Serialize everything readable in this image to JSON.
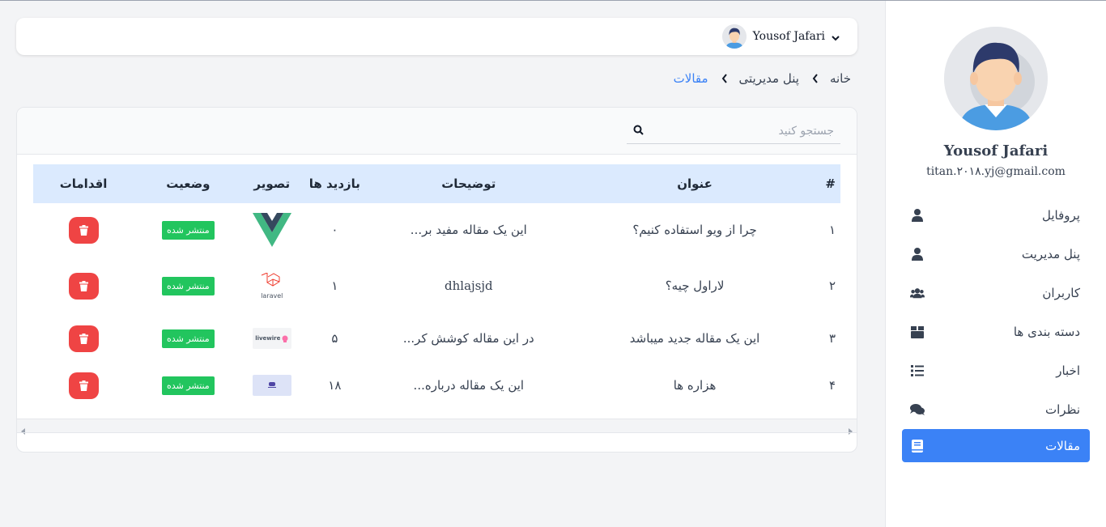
{
  "sidebar": {
    "user_name": "Yousof Jafari",
    "user_email": "titan.۲۰۱۸.yj@gmail.com",
    "avatar_icon": "user-avatar-icon",
    "items": [
      {
        "label": "پروفایل",
        "icon": "user-icon",
        "active": false
      },
      {
        "label": "پنل مدیریت",
        "icon": "user-icon",
        "active": false
      },
      {
        "label": "کاربران",
        "icon": "users-icon",
        "active": false
      },
      {
        "label": "دسته بندی ها",
        "icon": "box-icon",
        "active": false
      },
      {
        "label": "اخبار",
        "icon": "list-icon",
        "active": false
      },
      {
        "label": "نظرات",
        "icon": "comments-icon",
        "active": false
      },
      {
        "label": "مقالات",
        "icon": "book-icon",
        "active": true
      }
    ]
  },
  "topbar": {
    "user_name": "Yousof Jafari",
    "dropdown_icon": "chevron-down-icon"
  },
  "breadcrumb": {
    "items": [
      "خانه",
      "پنل مدیریتی",
      "مقالات"
    ]
  },
  "search": {
    "placeholder": "جستجو کنید",
    "icon": "search-icon"
  },
  "table": {
    "headers": [
      "#",
      "عنوان",
      "توضیحات",
      "بازدید ها",
      "تصویر",
      "وضعیت",
      "اقدامات"
    ],
    "rows": [
      {
        "num": "۱",
        "title": "چرا از ویو استفاده کنیم؟",
        "desc": "این یک مقاله مفید بر...",
        "views": "۰",
        "image": "vue-logo",
        "status": "منتشر شده"
      },
      {
        "num": "۲",
        "title": "لاراول چیه؟",
        "desc": "dhlajsjd",
        "views": "۱",
        "image": "laravel-logo",
        "status": "منتشر شده"
      },
      {
        "num": "۳",
        "title": "این یک مقاله جدید میباشد",
        "desc": "در این مقاله کوشش کر...",
        "views": "۵",
        "image": "livewire-logo",
        "status": "منتشر شده"
      },
      {
        "num": "۴",
        "title": "هزاره ها",
        "desc": "این یک مقاله درباره...",
        "views": "۱۸",
        "image": "generic-thumbnail",
        "status": "منتشر شده"
      }
    ]
  },
  "laravel_logo_text": "laravel",
  "livewire_logo_text": "livewire",
  "colors": {
    "accent": "#3b82f6",
    "header_bg": "#dbeafe",
    "badge_green": "#22c55e",
    "delete_red": "#ef4444"
  }
}
